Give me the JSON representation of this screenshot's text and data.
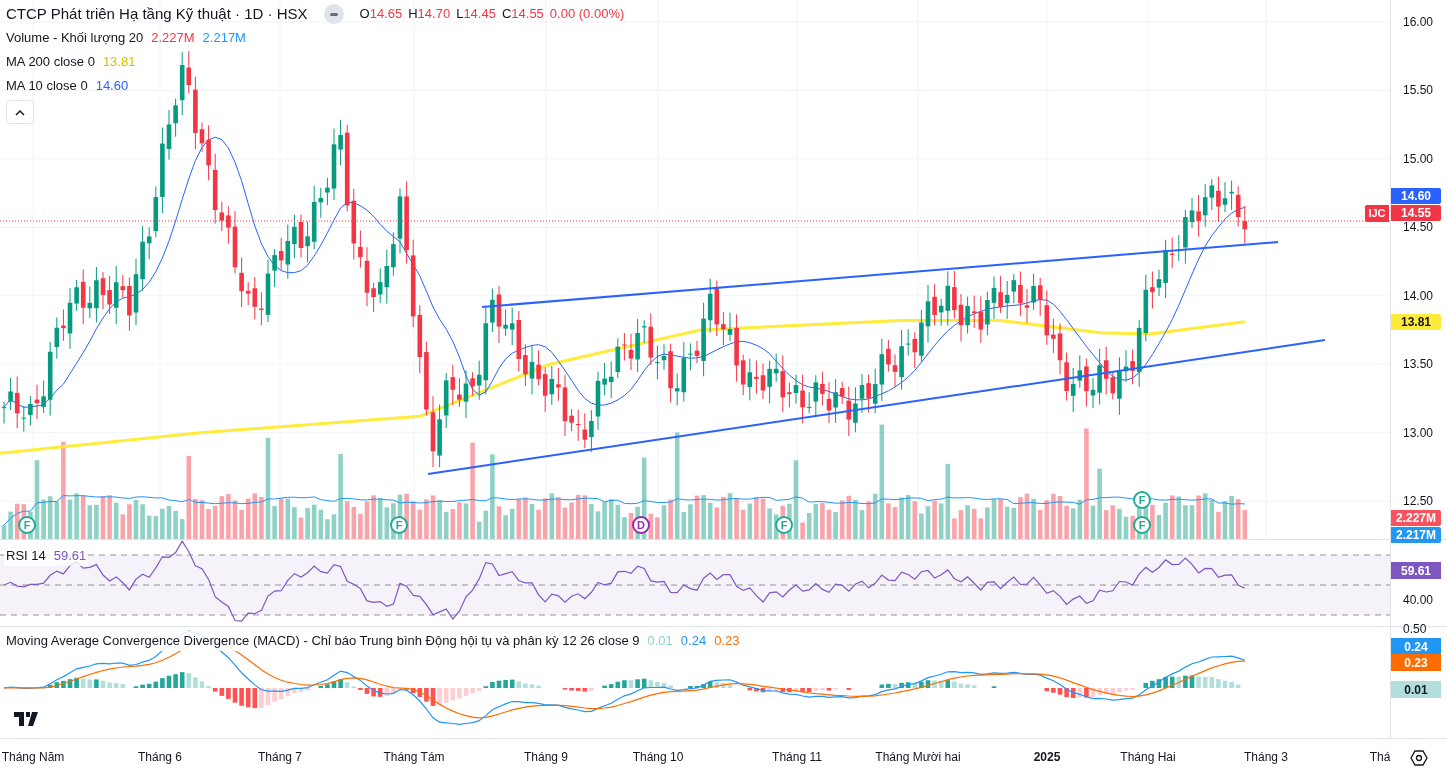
{
  "header": {
    "title": "CTCP Phát triên Hạ tầng Kỹ thuật · 1D · HSX",
    "ohlc": [
      {
        "label": "O",
        "value": "14.65"
      },
      {
        "label": "H",
        "value": "14.70"
      },
      {
        "label": "L",
        "value": "14.45"
      },
      {
        "label": "C",
        "value": "14.55"
      }
    ],
    "change": "0.00 (0.00%)"
  },
  "legends": [
    {
      "name": "Volume - Khối lượng 20",
      "values": [
        {
          "text": "2.227M",
          "color": "#f23645"
        },
        {
          "text": "2.217M",
          "color": "#2196f3"
        }
      ]
    },
    {
      "name": "MA 200 close 0",
      "values": [
        {
          "text": "13.81",
          "color": "#d9bf00"
        }
      ]
    },
    {
      "name": "MA 10 close 0",
      "values": [
        {
          "text": "14.60",
          "color": "#2962ff"
        }
      ]
    }
  ],
  "price_axis": {
    "ticks": [
      "16.00",
      "15.50",
      "15.00",
      "14.50",
      "14.00",
      "13.50",
      "13.00",
      "12.50"
    ],
    "tags": [
      {
        "text": "14.60",
        "color": "#2962ff"
      },
      {
        "text": "14.55",
        "color": "#f23645",
        "symbol": "IJC"
      },
      {
        "text": "13.81",
        "color": "#ffeb3b"
      },
      {
        "text": "2.227M",
        "color": "#f7525f"
      },
      {
        "text": "2.217M",
        "color": "#2196f3"
      }
    ]
  },
  "events": [
    {
      "label": "F",
      "color": "#22ab94"
    },
    {
      "label": "F",
      "color": "#22ab94"
    },
    {
      "label": "F",
      "color": "#22ab94"
    },
    {
      "label": "D",
      "color": "#9c27b0"
    },
    {
      "label": "F",
      "color": "#22ab94"
    },
    {
      "label": "F",
      "color": "#22ab94"
    }
  ],
  "rsi": {
    "title": "RSI 14",
    "value": "59.61",
    "tick": "40.00",
    "tag": "59.61"
  },
  "macd": {
    "title": "Moving Average Convergence Divergence (MACD) - Chỉ báo Trung bình Động hội tụ và phân kỳ 12 26 close 9",
    "values": [
      {
        "text": "0.01",
        "color": "#89d6c9"
      },
      {
        "text": "0.24",
        "color": "#2196f3"
      },
      {
        "text": "0.23",
        "color": "#ff6d00"
      }
    ],
    "tick": "0.50",
    "tags": [
      {
        "text": "0.24",
        "color": "#2196f3"
      },
      {
        "text": "0.23",
        "color": "#ff6d00"
      },
      {
        "text": "0.01",
        "color": "#b2dfdb"
      }
    ]
  },
  "time_axis": [
    {
      "label": "Tháng Năm",
      "bold": false
    },
    {
      "label": "Tháng 6",
      "bold": false
    },
    {
      "label": "Tháng 7",
      "bold": false
    },
    {
      "label": "Tháng Tám",
      "bold": false
    },
    {
      "label": "Tháng 9",
      "bold": false
    },
    {
      "label": "Tháng 10",
      "bold": false
    },
    {
      "label": "Tháng 11",
      "bold": false
    },
    {
      "label": "Tháng Mười hai",
      "bold": false
    },
    {
      "label": "2025",
      "bold": true
    },
    {
      "label": "Tháng Hai",
      "bold": false
    },
    {
      "label": "Tháng 3",
      "bold": false
    },
    {
      "label": "Thá",
      "bold": false
    }
  ]
}
